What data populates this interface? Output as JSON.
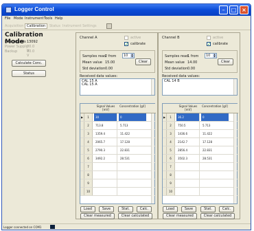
{
  "window": {
    "title": "Logger Control"
  },
  "menu": [
    "File",
    "Mode",
    "Instrument",
    "Tools",
    "Help"
  ],
  "toolbar": {
    "tabs": [
      "Acquisition",
      "Calibration",
      "Status",
      "Instrument Settings"
    ],
    "active_index": 1
  },
  "left": {
    "title": "Calibration Mode",
    "info": [
      {
        "label": "Free records",
        "value": "13092"
      },
      {
        "label": "Power Supply",
        "value": "00.0 V"
      },
      {
        "label": "Backup",
        "value": "00.0 V"
      }
    ],
    "calculate_label": "Calculate Conc.",
    "status_label": "Status"
  },
  "channels": [
    {
      "title": "Channel  A",
      "active_label": "active",
      "calibrate_label": "calibrate",
      "calibrate_checked": true,
      "samples_label": "Samples read",
      "samples_value": "2 from",
      "spin_value": "10",
      "mean_label": "Mean value",
      "mean_value": "15.00",
      "std_label": "Std deviation",
      "std_value": "0.00",
      "clear_label": "Clear",
      "received_label": "Received data values:",
      "received": [
        "CAL  15 A",
        "CAL  15 A"
      ],
      "col_signal": "Signal Values [mV]",
      "col_conc": "Concentration [g/l]",
      "rows": [
        {
          "n": "1",
          "signal": "30",
          "conc": "0"
        },
        {
          "n": "2",
          "signal": "713.8",
          "conc": "5.713"
        },
        {
          "n": "3",
          "signal": "1359.4",
          "conc": "11.422"
        },
        {
          "n": "4",
          "signal": "2065.7",
          "conc": "17.128"
        },
        {
          "n": "5",
          "signal": "2790.3",
          "conc": "22.831"
        },
        {
          "n": "6",
          "signal": "3492.2",
          "conc": "28.531"
        },
        {
          "n": "7",
          "signal": "",
          "conc": ""
        },
        {
          "n": "8",
          "signal": "",
          "conc": ""
        },
        {
          "n": "9",
          "signal": "",
          "conc": ""
        },
        {
          "n": "10",
          "signal": "",
          "conc": ""
        }
      ],
      "btn_load": "Load",
      "btn_save": "Save",
      "btn_stat": "Stat.",
      "btn_calc": "Calc.",
      "btn_clear_measured": "Clear measured",
      "btn_clear_calculated": "Clear calculated"
    },
    {
      "title": "Channel  B",
      "active_label": "active",
      "calibrate_label": "calibrate",
      "calibrate_checked": true,
      "samples_label": "Samples read",
      "samples_value": "1 from",
      "spin_value": "10",
      "mean_label": "Mean value",
      "mean_value": "14.00",
      "std_label": "Std deviation",
      "std_value": "0.00",
      "clear_label": "Clear",
      "received_label": "Received data values:",
      "received": [
        "CAL  14 B"
      ],
      "col_signal": "Signal Values [mV]",
      "col_conc": "Concentration [g/l]",
      "rows": [
        {
          "n": "1",
          "signal": "36.2",
          "conc": "0"
        },
        {
          "n": "2",
          "signal": "750.5",
          "conc": "5.713"
        },
        {
          "n": "3",
          "signal": "1436.6",
          "conc": "11.422"
        },
        {
          "n": "4",
          "signal": "2142.7",
          "conc": "17.128"
        },
        {
          "n": "5",
          "signal": "2856.4",
          "conc": "22.831"
        },
        {
          "n": "6",
          "signal": "3502.3",
          "conc": "28.531"
        },
        {
          "n": "7",
          "signal": "",
          "conc": ""
        },
        {
          "n": "8",
          "signal": "",
          "conc": ""
        },
        {
          "n": "9",
          "signal": "",
          "conc": ""
        },
        {
          "n": "10",
          "signal": "",
          "conc": ""
        }
      ],
      "btn_load": "Load",
      "btn_save": "Save",
      "btn_stat": "Stat.",
      "btn_calc": "Calc.",
      "btn_clear_measured": "Clear measured",
      "btn_clear_calculated": "Clear calculated"
    }
  ],
  "status": {
    "text": "Logger connected on COM1"
  }
}
